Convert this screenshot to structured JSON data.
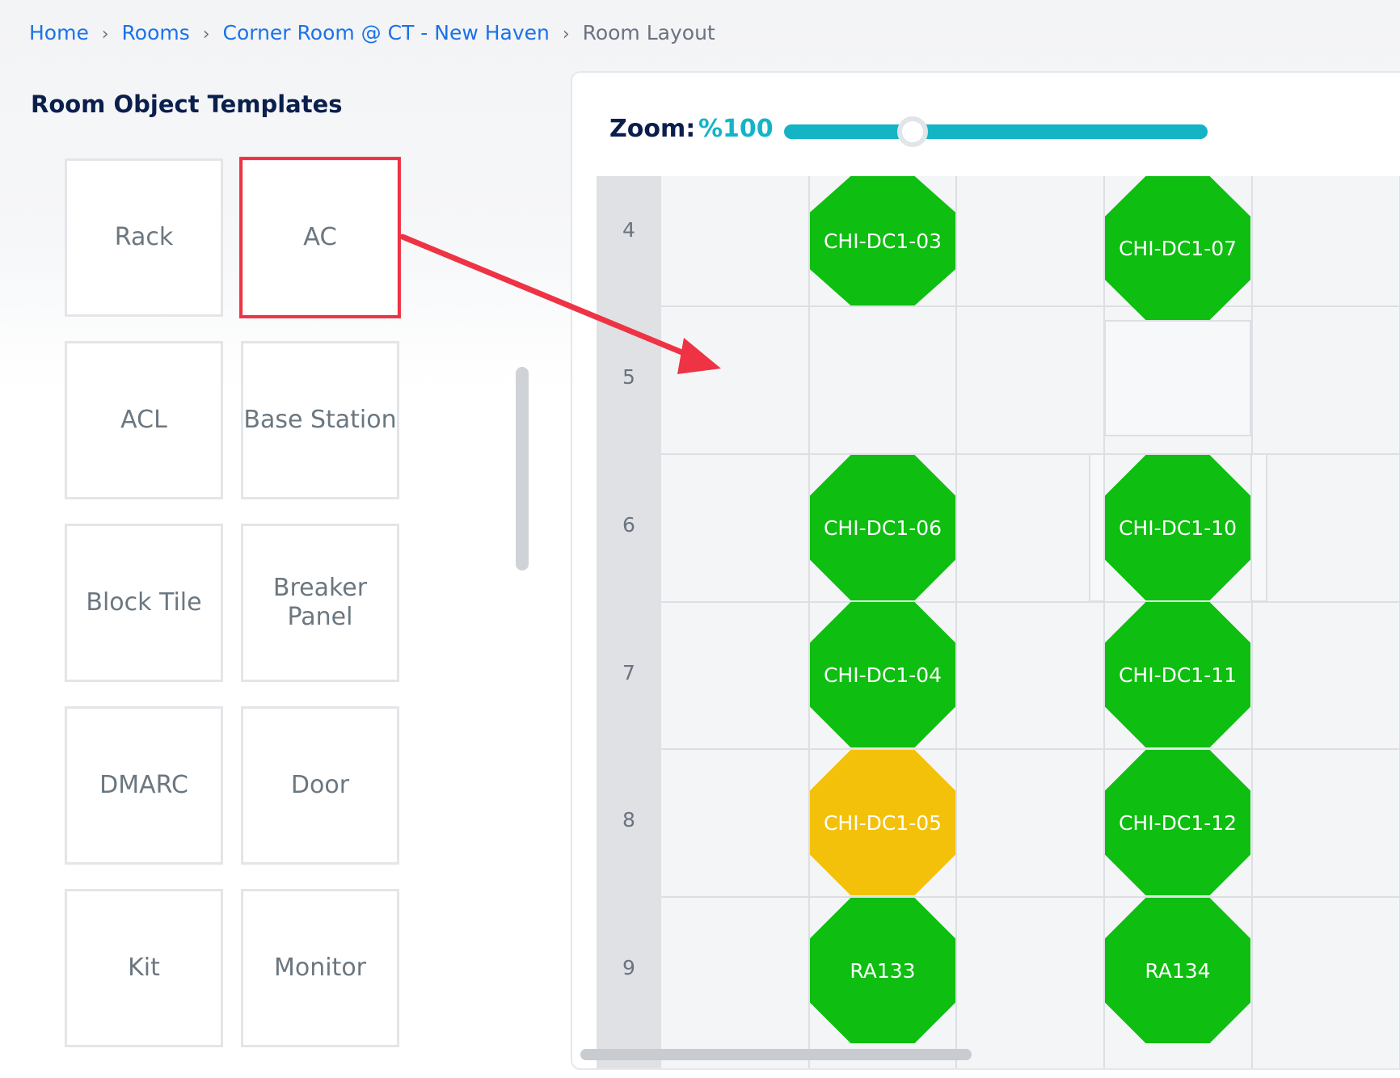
{
  "breadcrumb": {
    "items": [
      "Home",
      "Rooms",
      "Corner Room @ CT - New Haven"
    ],
    "current": "Room Layout"
  },
  "templates": {
    "title": "Room Object Templates",
    "items": [
      "Rack",
      "AC",
      "ACL",
      "Base Station",
      "Block Tile",
      "Breaker Panel",
      "DMARC",
      "Door",
      "Kit",
      "Monitor"
    ],
    "selected": "AC"
  },
  "zoom": {
    "label": "Zoom:",
    "value": "%100",
    "level_percent": 30
  },
  "rows": [
    "4",
    "5",
    "6",
    "7",
    "8",
    "9"
  ],
  "racks": [
    {
      "label": "CHI-DC1-03",
      "status": "ok"
    },
    {
      "label": "CHI-DC1-07",
      "status": "ok"
    },
    {
      "label": "CHI-DC1-06",
      "status": "ok"
    },
    {
      "label": "CHI-DC1-10",
      "status": "ok"
    },
    {
      "label": "CHI-DC1-04",
      "status": "ok"
    },
    {
      "label": "CHI-DC1-11",
      "status": "ok"
    },
    {
      "label": "CHI-DC1-05",
      "status": "warning"
    },
    {
      "label": "CHI-DC1-12",
      "status": "ok"
    },
    {
      "label": "RA133",
      "status": "ok"
    },
    {
      "label": "RA134",
      "status": "ok"
    }
  ],
  "colors": {
    "ok": "#0ebe10",
    "warning": "#f4c10a",
    "accent": "#14b4c6",
    "highlight": "#ee3344"
  }
}
